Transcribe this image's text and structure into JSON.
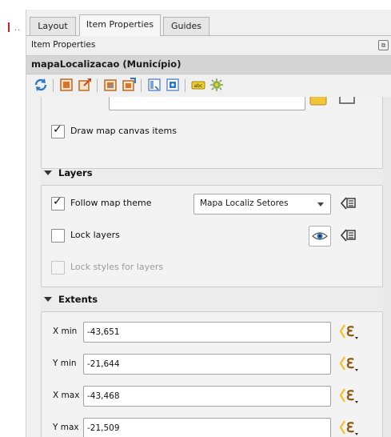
{
  "tabs": [
    {
      "label": "Layout"
    },
    {
      "label": "Item Properties"
    },
    {
      "label": "Guides"
    }
  ],
  "panel_title": "Item Properties",
  "item_title": "mapaLocalizacao (Município)",
  "toolbar_icons": [
    "refresh-icon",
    "zoom-to-item-icon",
    "export-icon",
    "lock-icon",
    "set-extent-icon",
    "map-canvas-icon",
    "view-extent-icon",
    "label-icon",
    "atlas-icon"
  ],
  "main_group": {
    "draw_canvas_items": {
      "label": "Draw map canvas items",
      "checked": true
    }
  },
  "layers": {
    "title": "Layers",
    "follow_theme": {
      "label": "Follow map theme",
      "checked": true
    },
    "theme_value": "Mapa Localiz Setores",
    "lock_layers": {
      "label": "Lock layers",
      "checked": false
    },
    "lock_styles": {
      "label": "Lock styles for layers",
      "checked": false,
      "enabled": false
    }
  },
  "extents": {
    "title": "Extents",
    "fields": [
      {
        "label": "X min",
        "value": "-43,651"
      },
      {
        "label": "Y min",
        "value": "-21,644"
      },
      {
        "label": "X max",
        "value": "-43,468"
      },
      {
        "label": "Y max",
        "value": "-21,509"
      }
    ]
  },
  "colors": {
    "expression_yellow": "#f2c43b",
    "expression_brown": "#8a5a12"
  }
}
